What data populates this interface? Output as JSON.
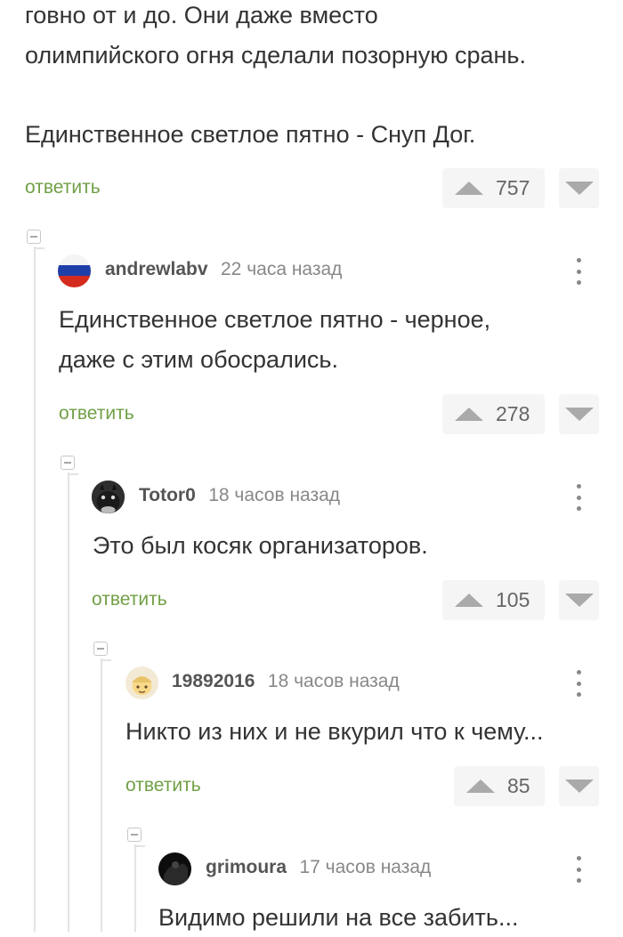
{
  "top_comment": {
    "lines": [
      "говно от и до. Они даже вместо",
      "олимпийского огня сделали позорную срань.",
      "",
      "Единственное светлое пятно - Снуп Дог."
    ],
    "reply_label": "ответить",
    "score": "757"
  },
  "comments": [
    {
      "author": "andrewlabv",
      "time": "22 часа назад",
      "avatar_icon": "russian-flag-avatar",
      "lines": [
        "Единственное светлое пятно - черное,",
        "даже с этим обосрались."
      ],
      "reply_label": "ответить",
      "score": "278"
    },
    {
      "author": "Totor0",
      "time": "18 часов назад",
      "avatar_icon": "totoro-avatar",
      "lines": [
        "Это был косяк организаторов."
      ],
      "reply_label": "ответить",
      "score": "105"
    },
    {
      "author": "19892016",
      "time": "18 часов назад",
      "avatar_icon": "cartoon-character-avatar",
      "lines": [
        "Никто из них и не вкурил что к чему..."
      ],
      "reply_label": "ответить",
      "score": "85"
    },
    {
      "author": "grimoura",
      "time": "17 часов назад",
      "avatar_icon": "dark-photo-avatar",
      "lines": [
        "Видимо решили на все забить..."
      ]
    }
  ],
  "colors": {
    "reply_link": "#71a046",
    "text": "#333333",
    "vote_bg": "#f5f5f5",
    "thread_line": "#e3e3e3"
  }
}
